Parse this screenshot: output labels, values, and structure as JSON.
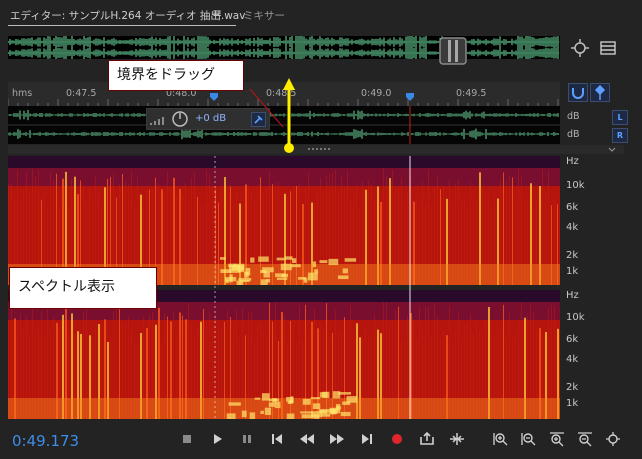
{
  "tabs": {
    "editor": "エディター: サンプルH.264 オーディオ 抽出.wav",
    "menu_glyph": "≡",
    "mixer": "ミキサー"
  },
  "ruler": {
    "units": "hms",
    "ticks": [
      "0:47.5",
      "0:48.0",
      "0:48.5",
      "0:49.0",
      "0:49.5"
    ]
  },
  "waveform": {
    "db_top": "dB",
    "db_bottom": "dB",
    "left_channel": "L",
    "right_channel": "R",
    "hud_gain": "+0 dB"
  },
  "spectrogram": {
    "axis_unit": "Hz",
    "labels": [
      "10k",
      "6k",
      "4k",
      "2k",
      "1k"
    ]
  },
  "callouts": {
    "drag_boundary": "境界をドラッグ",
    "spectral_display": "スペクトル表示"
  },
  "transport": {
    "timecode": "0:49.173"
  },
  "colors": {
    "accent": "#3d8ee8",
    "callout_border": "#6b0000",
    "arrow": "#ffee00",
    "playhead": "#c51f1f"
  }
}
